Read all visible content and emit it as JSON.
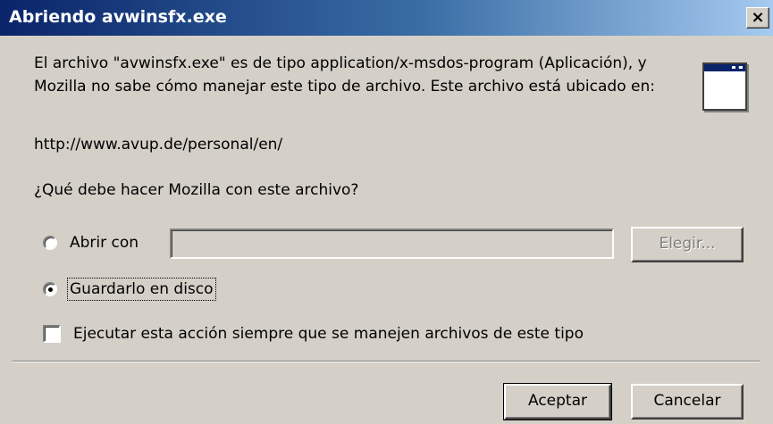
{
  "window": {
    "title": "Abriendo avwinsfx.exe",
    "close_label": "×"
  },
  "dialog": {
    "message": "El archivo \"avwinsfx.exe\" es de tipo application/x-msdos-program (Aplicación), y Mozilla no sabe cómo manejar este tipo de archivo. Este archivo está ubicado en:",
    "url": "http://www.avup.de/personal/en/",
    "question": "¿Qué debe hacer Mozilla con este archivo?",
    "icon": "application-window-icon"
  },
  "options": {
    "open_with_label": "Abrir con",
    "open_with_path": "",
    "choose_button": "Elegir...",
    "save_label": "Guardarlo en disco",
    "selected": "save"
  },
  "always_checkbox": {
    "label": "Ejecutar esta acción siempre que se manejen archivos de este tipo",
    "checked": false
  },
  "buttons": {
    "accept": "Aceptar",
    "cancel": "Cancelar"
  }
}
